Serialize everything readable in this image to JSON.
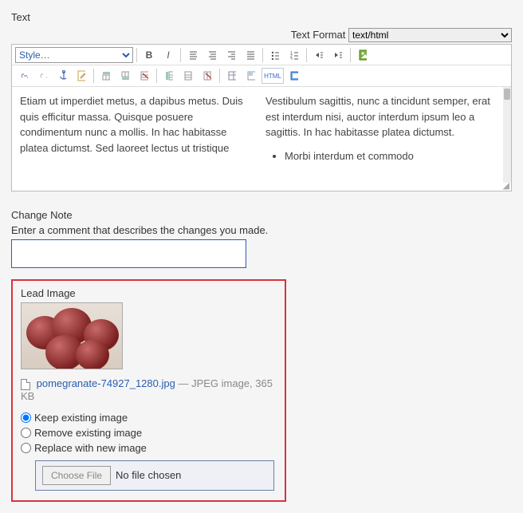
{
  "text_section": {
    "label": "Text",
    "format_label": "Text Format",
    "format_value": "text/html",
    "style_dropdown": "Style…",
    "body_left": "Etiam ut imperdiet metus, a dapibus metus. Duis quis efficitur massa. Quisque posuere condimentum nunc a mollis. In hac habitasse platea dictumst. Sed laoreet lectus ut tristique",
    "body_right": "Vestibulum sagittis, nunc a tincidunt semper, erat est interdum nisi, auctor interdum ipsum leo a sagittis. In hac habitasse platea dictumst.",
    "list_item": "Morbi interdum et commodo"
  },
  "change_note": {
    "label": "Change Note",
    "help": "Enter a comment that describes the changes you made.",
    "value": ""
  },
  "lead_image": {
    "label": "Lead Image",
    "filename": "pomegranate-74927_1280.jpg",
    "meta": " — JPEG image, 365 KB",
    "options": {
      "keep": "Keep existing image",
      "remove": "Remove existing image",
      "replace": "Replace with new image"
    },
    "choose_button": "Choose File",
    "no_file": "No file chosen"
  }
}
